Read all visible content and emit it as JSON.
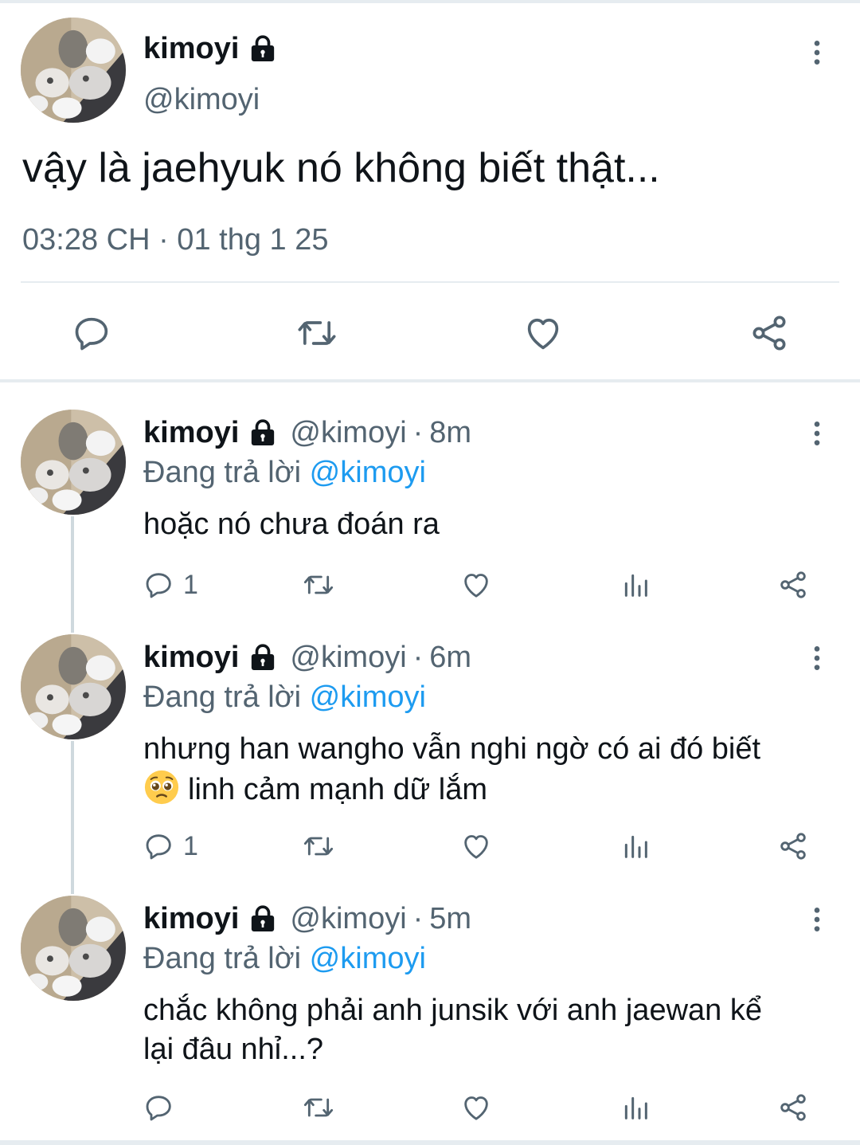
{
  "main_tweet": {
    "display_name": "kimoyi",
    "handle": "@kimoyi",
    "text": "vậy là jaehyuk nó không biết thật...",
    "timestamp": "03:28 CH · 01 thg 1 25",
    "actions": [
      "reply-icon",
      "retweet-icon",
      "like-icon",
      "share-icon"
    ]
  },
  "replies": [
    {
      "display_name": "kimoyi",
      "handle": "@kimoyi",
      "separator": "·",
      "time_ago": "8m",
      "replying_prefix": "Đang trả lời",
      "replying_to": "@kimoyi",
      "text": "hoặc nó chưa đoán ra",
      "text_line2": "",
      "reply_count": "1"
    },
    {
      "display_name": "kimoyi",
      "handle": "@kimoyi",
      "separator": "·",
      "time_ago": "6m",
      "replying_prefix": "Đang trả lời",
      "replying_to": "@kimoyi",
      "text": "nhưng han wangho vẫn nghi ngờ có ai đó biết",
      "text_line2": "linh cảm mạnh dữ lắm",
      "emoji": "pleading-face-emoji",
      "reply_count": "1"
    },
    {
      "display_name": "kimoyi",
      "handle": "@kimoyi",
      "separator": "·",
      "time_ago": "5m",
      "replying_prefix": "Đang trả lời",
      "replying_to": "@kimoyi",
      "text": "chắc không phải anh junsik với anh jaewan kể",
      "text_line2": "lại đâu nhỉ...?",
      "reply_count": ""
    }
  ],
  "colors": {
    "text": "#0f1419",
    "secondary": "#536471",
    "mention": "#1d9bf0",
    "divider": "#e6ecf0"
  }
}
